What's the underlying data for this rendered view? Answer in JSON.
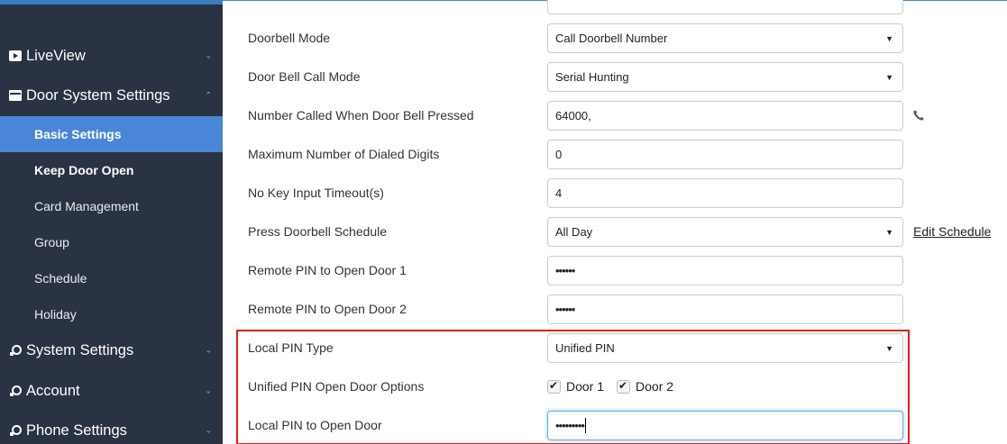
{
  "sidebar": {
    "liveview": "LiveView",
    "door_system_settings": "Door System Settings",
    "sub_items": [
      "Basic Settings",
      "Keep Door Open",
      "Card Management",
      "Group",
      "Schedule",
      "Holiday"
    ],
    "system_settings": "System Settings",
    "account": "Account",
    "phone_settings": "Phone Settings"
  },
  "form": {
    "doorbell_mode": {
      "label": "Doorbell Mode",
      "value": "Call Doorbell Number"
    },
    "door_bell_call_mode": {
      "label": "Door Bell Call Mode",
      "value": "Serial Hunting"
    },
    "number_called": {
      "label": "Number Called When Door Bell Pressed",
      "value": "64000,"
    },
    "max_dialed_digits": {
      "label": "Maximum Number of Dialed Digits",
      "value": "0"
    },
    "no_key_timeout": {
      "label": "No Key Input Timeout(s)",
      "value": "4"
    },
    "press_doorbell_schedule": {
      "label": "Press Doorbell Schedule",
      "value": "All Day",
      "link": "Edit Schedule"
    },
    "remote_pin_door1": {
      "label": "Remote PIN to Open Door 1",
      "value": "••••••"
    },
    "remote_pin_door2": {
      "label": "Remote PIN to Open Door 2",
      "value": "••••••"
    },
    "local_pin_type": {
      "label": "Local PIN Type",
      "value": "Unified PIN"
    },
    "unified_pin_options": {
      "label": "Unified PIN Open Door Options",
      "door1": "Door 1",
      "door2": "Door 2"
    },
    "local_pin_open_door": {
      "label": "Local PIN to Open Door",
      "value": "•••••••••"
    }
  }
}
